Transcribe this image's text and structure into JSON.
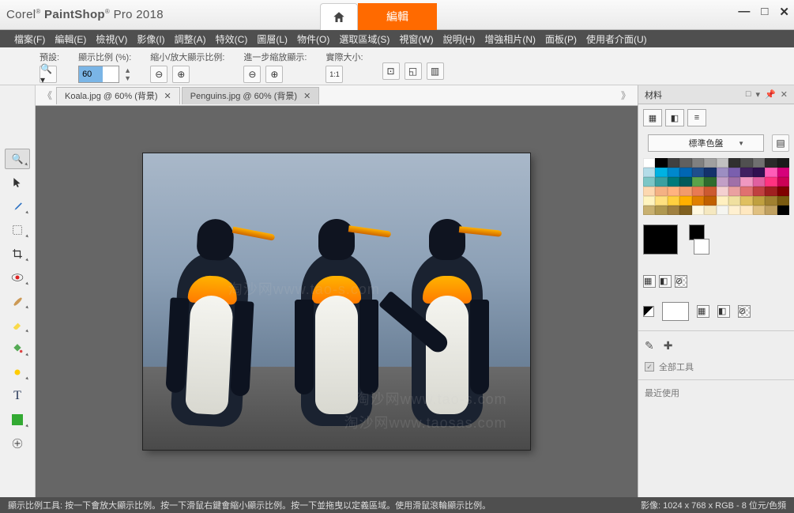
{
  "title": {
    "brand": "Corel",
    "product": "PaintShop",
    "sub": "Pro 2018"
  },
  "topbuttons": {
    "edit": "編輯"
  },
  "menu": [
    "檔案(F)",
    "編輯(E)",
    "檢視(V)",
    "影像(I)",
    "調整(A)",
    "特效(C)",
    "圖層(L)",
    "物件(O)",
    "選取區域(S)",
    "視窗(W)",
    "說明(H)",
    "增強相片(N)",
    "面板(P)",
    "使用者介面(U)"
  ],
  "optbar": {
    "preset": "預設:",
    "zoompct": "顯示比例 (%):",
    "zoomval": "60",
    "zoomby": "縮小/放大顯示比例:",
    "zoomstep": "進一步縮放顯示:",
    "actual": "實際大小:"
  },
  "tabs": [
    {
      "label": "Koala.jpg @   60% (背景)",
      "active": false
    },
    {
      "label": "Penguins.jpg @   60% (背景)",
      "active": true
    }
  ],
  "watermarks": [
    "淘沙网www.tao-s.com",
    "淘沙网www.tao-s.com",
    "淘沙网www.taosas.com"
  ],
  "rightpanel": {
    "title": "材料",
    "dropdown": "標準色盤",
    "alltools": "全部工具",
    "recent": "最近使用"
  },
  "status": {
    "left": "顯示比例工具: 按一下會放大顯示比例。按一下滑鼠右鍵會縮小顯示比例。按一下並拖曳以定義區域。使用滑鼠滾輪顯示比例。",
    "right": "影像:  1024 x 768 x RGB - 8 位元/色頻"
  },
  "palette_colors": [
    "#ffffff",
    "#000000",
    "#404040",
    "#606060",
    "#808080",
    "#a0a0a0",
    "#c0c0c0",
    "#303030",
    "#505050",
    "#707070",
    "#2a2a2a",
    "#1a1a1a",
    "#b4dce8",
    "#00b2e2",
    "#0088cc",
    "#0066b3",
    "#1f4e8c",
    "#14326b",
    "#9c8ec2",
    "#7a5fae",
    "#402060",
    "#301050",
    "#ff5cb8",
    "#d6007a",
    "#7cc6c6",
    "#3aa0a0",
    "#007a7a",
    "#005a5a",
    "#5aa34a",
    "#2e6b2e",
    "#c29fc6",
    "#a070a8",
    "#f098c0",
    "#e060a0",
    "#ff3380",
    "#cc0055",
    "#fdd8b0",
    "#f4b183",
    "#ffb380",
    "#f29b6c",
    "#e87a53",
    "#cc5a30",
    "#f4d0d0",
    "#eaa0a0",
    "#e07070",
    "#c04040",
    "#a02020",
    "#800000",
    "#fff4c0",
    "#ffe080",
    "#ffd040",
    "#ffb000",
    "#e08000",
    "#c06000",
    "#fff0c0",
    "#f0e0a0",
    "#e0c060",
    "#c0a040",
    "#a08030",
    "#7a5a10",
    "#c8b070",
    "#b09850",
    "#a08040",
    "#806020",
    "#fff8e0",
    "#f5e8c0",
    "#f5f5f0",
    "#fff0d0",
    "#ffe8c0",
    "#e0c080",
    "#c0a060",
    "#000000"
  ]
}
